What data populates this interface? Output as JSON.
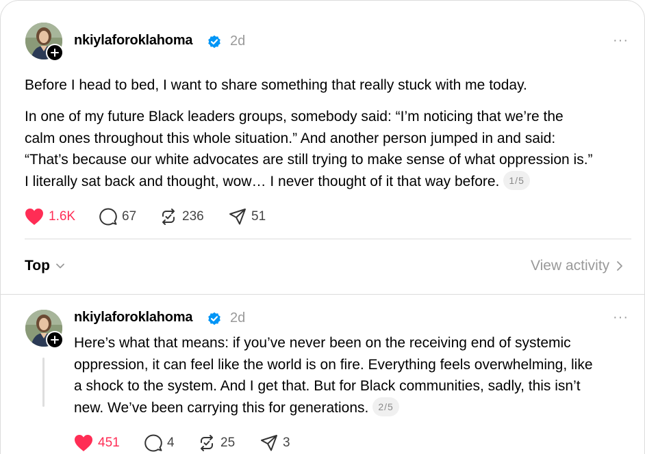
{
  "post": {
    "username": "nkiylaforoklahoma",
    "time": "2d",
    "more": "···",
    "paragraph1": "Before I head to bed, I want to share something that really stuck with me today.",
    "paragraph2_lines": [
      "In one of my future Black leaders groups, somebody said: “I’m noticing that we’re the",
      "calm ones throughout this whole situation.” And another person jumped in and said:",
      "“That’s because our white advocates are still trying to make sense of what oppression is.”",
      "I literally sat back and thought, wow… I never thought of it that way before."
    ],
    "page_indicator": "1/5",
    "likes": "1.6K",
    "replies": "67",
    "reposts": "236",
    "shares": "51"
  },
  "sort": {
    "label": "Top"
  },
  "view_activity": {
    "label": "View activity"
  },
  "reply": {
    "username": "nkiylaforoklahoma",
    "time": "2d",
    "more": "···",
    "lines": [
      "Here’s what that means: if you’ve never been on the receiving end of systemic",
      "oppression, it can feel like the world is on fire. Everything feels overwhelming, like",
      "a shock to the system. And I get that. But for Black communities, sadly, this isn’t",
      "new. We’ve been carrying this for generations."
    ],
    "page_indicator": "2/5",
    "likes": "451",
    "replies": "4",
    "reposts": "25",
    "shares": "3"
  },
  "colors": {
    "like": "#ff2d55",
    "verified": "#0095f6",
    "muted": "#999999"
  },
  "icons": [
    "heart-icon",
    "comment-icon",
    "repost-icon",
    "share-icon",
    "verified-badge-icon",
    "chevron-down-icon",
    "chevron-right-icon",
    "plus-icon"
  ]
}
